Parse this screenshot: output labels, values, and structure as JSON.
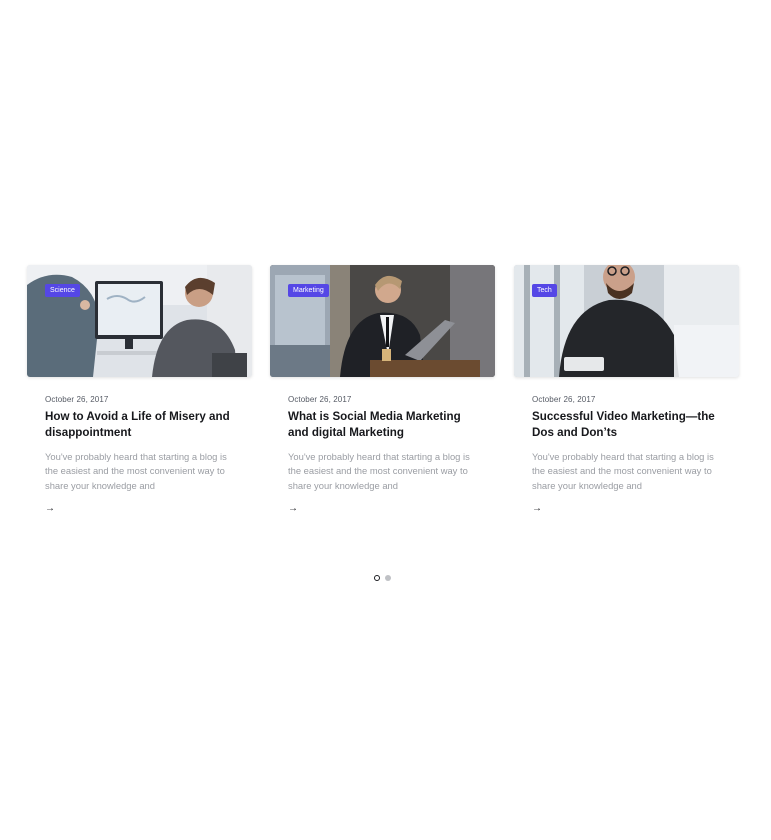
{
  "colors": {
    "badge": "#5547e6",
    "title": "#17181c",
    "excerpt": "#9a9da3",
    "dot_inactive": "#bfc1c5"
  },
  "posts": [
    {
      "category": "Science",
      "date": "October 26, 2017",
      "title": "How to Avoid a Life of Misery and disappointment",
      "excerpt": "You've probably heard that starting a blog is the easiest and the most convenient way to share your knowledge and",
      "more": "→",
      "image": "photo of two men working at a desktop computer"
    },
    {
      "category": "Marketing",
      "date": "October 26, 2017",
      "title": "What is Social Media Marketing and digital Marketing",
      "excerpt": "You've probably heard that starting a blog is the easiest and the most convenient way to share your knowledge and",
      "more": "→",
      "image": "photo of a businessman in suit working on laptop"
    },
    {
      "category": "Tech",
      "date": "October 26, 2017",
      "title": "Successful Video Marketing—the Dos and Don’ts",
      "excerpt": "You've probably heard that starting a blog is the easiest and the most convenient way to share your knowledge and",
      "more": "→",
      "image": "photo of a bearded man with glasses holding a tablet"
    }
  ],
  "pagination": {
    "active_index": 0,
    "total": 2
  }
}
